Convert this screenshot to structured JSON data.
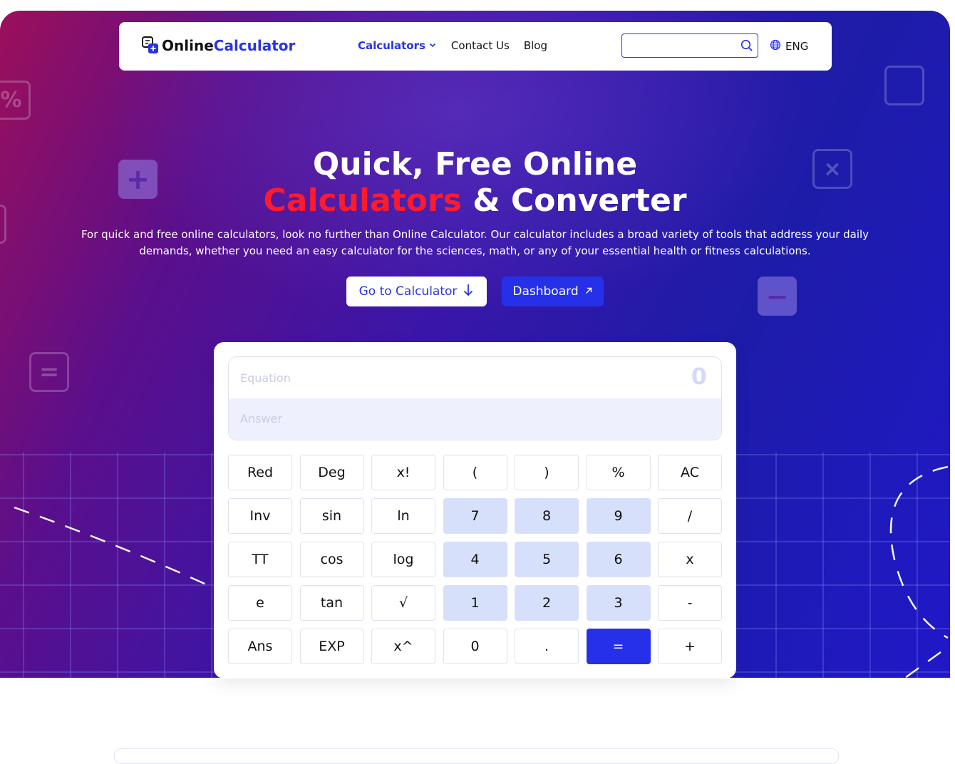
{
  "nav": {
    "logo_main": "Online",
    "logo_accent": "Calculator",
    "links": [
      {
        "label": "Calculators",
        "active": true,
        "has_dropdown": true
      },
      {
        "label": "Contact Us",
        "active": false
      },
      {
        "label": "Blog",
        "active": false
      }
    ],
    "search": {
      "value": "",
      "placeholder": ""
    },
    "language": "ENG"
  },
  "hero": {
    "title_line1": "Quick, Free Online",
    "title_red": "Calculators",
    "title_rest": " & Converter",
    "description": "For quick and free online calculators, look no further than Online Calculator. Our calculator includes a broad variety of tools that address your daily demands, whether you need an easy calculator for the sciences, math, or any of your essential health or fitness calculations.",
    "primary_button": "Go to Calculator",
    "secondary_button": "Dashboard"
  },
  "decorations": {
    "percent": "%",
    "plus": "+",
    "times": "×",
    "minus": "−",
    "equals": "="
  },
  "calculator": {
    "equation_placeholder": "Equation",
    "answer_placeholder": "Answer",
    "display_value": "0",
    "keys": [
      {
        "label": "Red",
        "kind": "func",
        "name": "key-red"
      },
      {
        "label": "Deg",
        "kind": "func",
        "name": "key-deg"
      },
      {
        "label": "x!",
        "kind": "func",
        "name": "key-factorial"
      },
      {
        "label": "(",
        "kind": "func",
        "name": "key-open-paren"
      },
      {
        "label": ")",
        "kind": "func",
        "name": "key-close-paren"
      },
      {
        "label": "%",
        "kind": "func",
        "name": "key-percent"
      },
      {
        "label": "AC",
        "kind": "func",
        "name": "key-all-clear"
      },
      {
        "label": "Inv",
        "kind": "func",
        "name": "key-inv"
      },
      {
        "label": "sin",
        "kind": "func",
        "name": "key-sin"
      },
      {
        "label": "ln",
        "kind": "func",
        "name": "key-ln"
      },
      {
        "label": "7",
        "kind": "num",
        "name": "key-7"
      },
      {
        "label": "8",
        "kind": "num",
        "name": "key-8"
      },
      {
        "label": "9",
        "kind": "num",
        "name": "key-9"
      },
      {
        "label": "/",
        "kind": "func",
        "name": "key-divide"
      },
      {
        "label": "TT",
        "kind": "func",
        "name": "key-pi"
      },
      {
        "label": "cos",
        "kind": "func",
        "name": "key-cos"
      },
      {
        "label": "log",
        "kind": "func",
        "name": "key-log"
      },
      {
        "label": "4",
        "kind": "num",
        "name": "key-4"
      },
      {
        "label": "5",
        "kind": "num",
        "name": "key-5"
      },
      {
        "label": "6",
        "kind": "num",
        "name": "key-6"
      },
      {
        "label": "x",
        "kind": "func",
        "name": "key-multiply"
      },
      {
        "label": "e",
        "kind": "func",
        "name": "key-e"
      },
      {
        "label": "tan",
        "kind": "func",
        "name": "key-tan"
      },
      {
        "label": "√",
        "kind": "func",
        "name": "key-sqrt"
      },
      {
        "label": "1",
        "kind": "num",
        "name": "key-1"
      },
      {
        "label": "2",
        "kind": "num",
        "name": "key-2"
      },
      {
        "label": "3",
        "kind": "num",
        "name": "key-3"
      },
      {
        "label": "-",
        "kind": "func",
        "name": "key-subtract"
      },
      {
        "label": "Ans",
        "kind": "func",
        "name": "key-ans"
      },
      {
        "label": "EXP",
        "kind": "func",
        "name": "key-exp"
      },
      {
        "label": "x^",
        "kind": "func",
        "name": "key-power"
      },
      {
        "label": "0",
        "kind": "func",
        "name": "key-0"
      },
      {
        "label": ".",
        "kind": "func",
        "name": "key-decimal"
      },
      {
        "label": "=",
        "kind": "eq",
        "name": "key-equals"
      },
      {
        "label": "+",
        "kind": "func",
        "name": "key-add"
      }
    ]
  },
  "colors": {
    "accent": "#2733e6",
    "title_red": "#ff1a2e",
    "numpad": "#d7e0fb",
    "equals": "#2630e8"
  }
}
